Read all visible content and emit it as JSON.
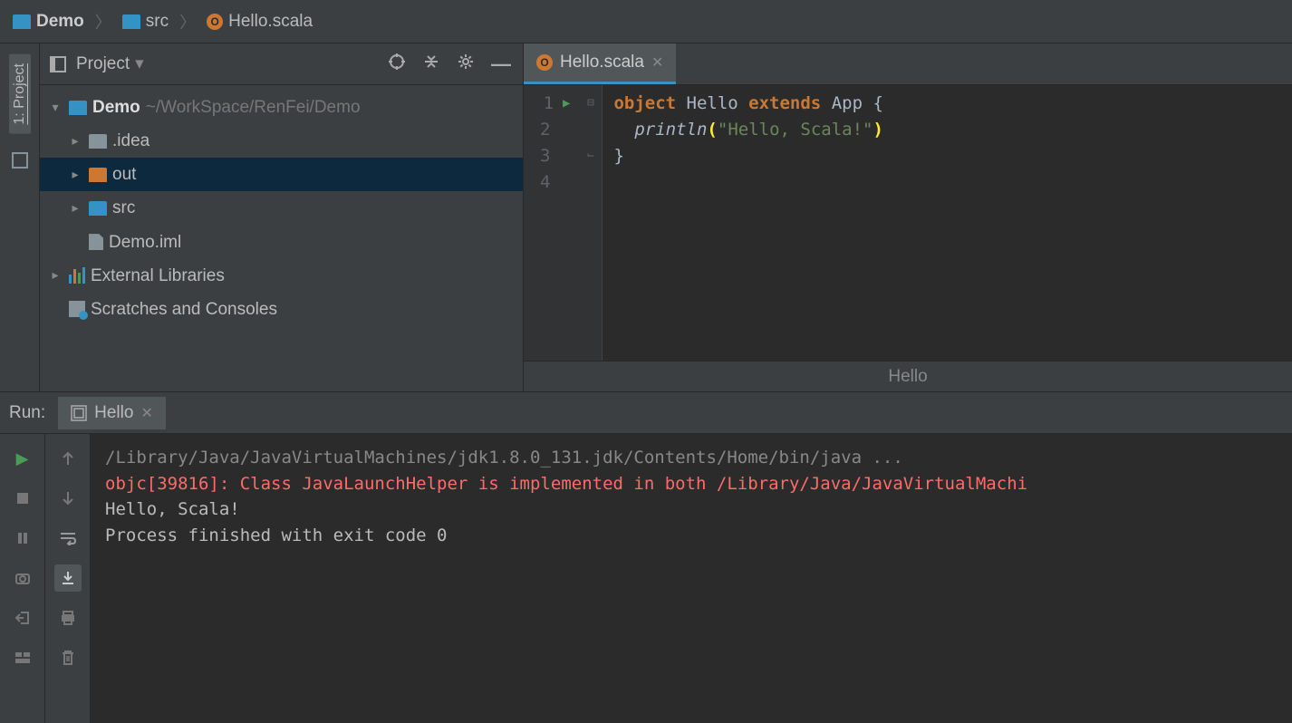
{
  "breadcrumb": [
    {
      "icon": "folder-blue",
      "label": "Demo",
      "bold": true
    },
    {
      "icon": "folder-blue",
      "label": "src",
      "bold": false
    },
    {
      "icon": "scala",
      "label": "Hello.scala",
      "bold": false
    }
  ],
  "sidebar": {
    "vert_tab": "1: Project"
  },
  "project": {
    "title": "Project",
    "tree": [
      {
        "depth": 0,
        "arrow": "▾",
        "icon": "folder-blue",
        "label": "Demo",
        "gray": " ~/WorkSpace/RenFei/Demo",
        "bold": true,
        "selected": false
      },
      {
        "depth": 1,
        "arrow": "▸",
        "icon": "folder-gray",
        "label": ".idea",
        "selected": false
      },
      {
        "depth": 1,
        "arrow": "▸",
        "icon": "folder-orange",
        "label": "out",
        "selected": true
      },
      {
        "depth": 1,
        "arrow": "▸",
        "icon": "folder-blue",
        "label": "src",
        "selected": false
      },
      {
        "depth": 1,
        "arrow": "",
        "icon": "iml",
        "label": "Demo.iml",
        "selected": false
      },
      {
        "depth": 0,
        "arrow": "▸",
        "icon": "lib",
        "label": "External Libraries",
        "selected": false
      },
      {
        "depth": 0,
        "arrow": "",
        "icon": "scratch",
        "label": "Scratches and Consoles",
        "selected": false
      }
    ]
  },
  "editor": {
    "tab": "Hello.scala",
    "lines": [
      "1",
      "2",
      "3",
      "4"
    ],
    "code": {
      "line1_kw_object": "object",
      "line1_name": " Hello ",
      "line1_kw_extends": "extends",
      "line1_app": " App ",
      "line1_brace": "{",
      "line2_indent": "  ",
      "line2_fn": "println",
      "line2_open": "(",
      "line2_str": "\"Hello, Scala!\"",
      "line2_close": ")",
      "line3_brace": "}"
    },
    "status": "Hello"
  },
  "run": {
    "label": "Run:",
    "tab": "Hello",
    "output": {
      "l1": "/Library/Java/JavaVirtualMachines/jdk1.8.0_131.jdk/Contents/Home/bin/java ...",
      "l2": "objc[39816]: Class JavaLaunchHelper is implemented in both /Library/Java/JavaVirtualMachi",
      "l3": "Hello, Scala!",
      "l4": "",
      "l5": "Process finished with exit code 0"
    }
  }
}
